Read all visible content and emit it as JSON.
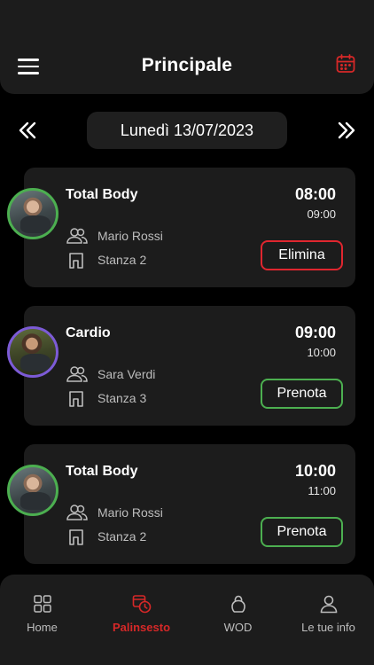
{
  "header": {
    "title": "Principale",
    "menu_icon": "hamburger-icon",
    "calendar_icon": "calendar-icon"
  },
  "date_nav": {
    "label": "Lunedì 13/07/2023",
    "prev_icon": "double-chevron-left-icon",
    "next_icon": "double-chevron-right-icon"
  },
  "classes": [
    {
      "title": "Total Body",
      "time": "08:00",
      "end_time": "09:00",
      "trainer": "Mario Rossi",
      "room": "Stanza 2",
      "action": "Elimina",
      "action_color": "#e0262f",
      "avatar_border": "#4caf50"
    },
    {
      "title": "Cardio",
      "time": "09:00",
      "end_time": "10:00",
      "trainer": "Sara Verdi",
      "room": "Stanza 3",
      "action": "Prenota",
      "action_color": "#4caf50",
      "avatar_border": "#7c5bd6"
    },
    {
      "title": "Total Body",
      "time": "10:00",
      "end_time": "11:00",
      "trainer": "Mario Rossi",
      "room": "Stanza 2",
      "action": "Prenota",
      "action_color": "#4caf50",
      "avatar_border": "#4caf50"
    }
  ],
  "tabbar": {
    "tabs": [
      {
        "label": "Home",
        "icon": "grid-icon",
        "active": false
      },
      {
        "label": "Palinsesto",
        "icon": "schedule-icon",
        "active": true
      },
      {
        "label": "WOD",
        "icon": "kettlebell-icon",
        "active": false
      },
      {
        "label": "Le tue info",
        "icon": "user-icon",
        "active": false
      }
    ]
  },
  "colors": {
    "accent": "#d62828",
    "card_bg": "#1c1c1c",
    "background": "#000000"
  }
}
